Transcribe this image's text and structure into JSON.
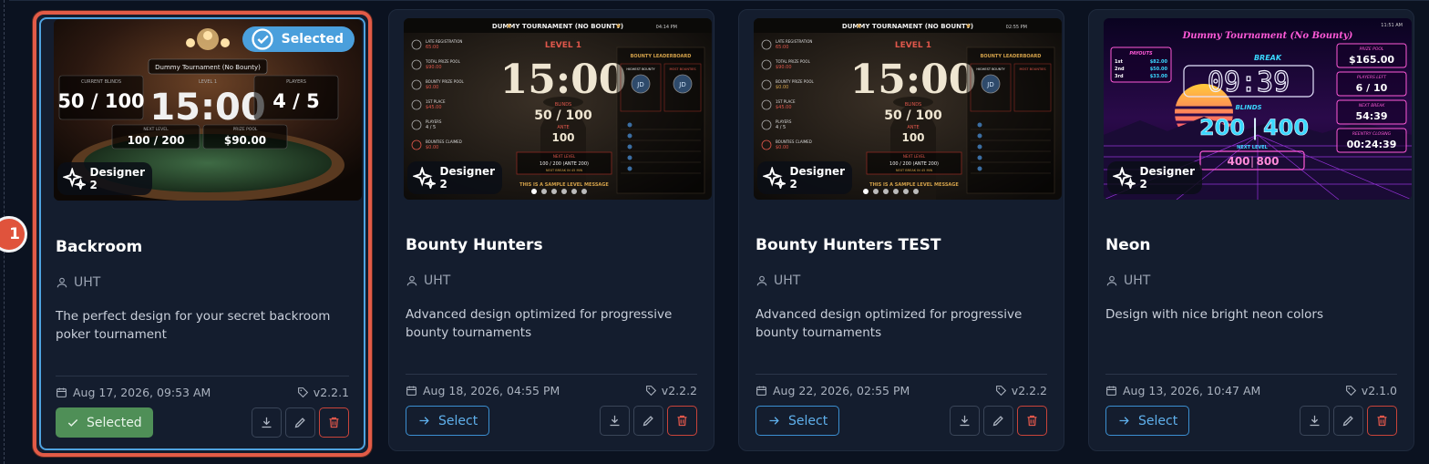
{
  "step_badge": "1",
  "cards": [
    {
      "title": "Backroom",
      "author": "UHT",
      "description": "The perfect design for your secret backroom poker tournament",
      "date": "Aug 17, 2026, 09:53 AM",
      "version": "v2.2.1",
      "designer": "Designer 2",
      "selected_chip": "Selected",
      "action_label": "Selected",
      "preview": {
        "header": "Dummy Tournament (No Bounty)",
        "blinds_label": "CURRENT BLINDS",
        "blinds": "50 / 100",
        "level_label": "LEVEL 1",
        "timer": "15:00",
        "players_label": "PLAYERS",
        "players": "4 / 5",
        "next_label": "NEXT LEVEL",
        "next_blinds": "100 / 200",
        "prize_label": "PRIZE POOL",
        "prize": "$90.00"
      }
    },
    {
      "title": "Bounty Hunters",
      "author": "UHT",
      "description": "Advanced design optimized for progressive bounty tournaments",
      "date": "Aug 18, 2026, 04:55 PM",
      "version": "v2.2.2",
      "designer": "Designer 2",
      "action_label": "Select",
      "preview": {
        "header": "DUMMY TOURNAMENT (NO BOUNTY)",
        "clock": "04:14 PM",
        "level": "LEVEL 1",
        "timer": "15:00",
        "blinds_label": "BLINDS",
        "blinds": "50 / 100",
        "ante_label": "ANTE",
        "ante": "100",
        "next_label": "NEXT LEVEL",
        "next_blinds": "100 / 200 (ANTE 200)",
        "next_break": "NEXT BREAK IN 45 MIN",
        "message": "THIS IS A SAMPLE LEVEL MESSAGE",
        "leaderboard": "BOUNTY LEADERBOARD",
        "highest_bounty": "HIGHEST BOUNTY",
        "most_bounties": "MOST BOUNTIES",
        "initials": "JD",
        "stats": [
          {
            "label": "LATE REGISTRATION",
            "value": "65:00"
          },
          {
            "label": "TOTAL PRIZE POOL",
            "value": "$90.00"
          },
          {
            "label": "BOUNTY PRIZE POOL",
            "value": "$0.00"
          },
          {
            "label": "1ST PLACE",
            "value": "$45.00"
          },
          {
            "label": "PLAYERS",
            "value": "4 / 5"
          },
          {
            "label": "BOUNTIES CLAIMED",
            "value": "$0.00"
          }
        ]
      }
    },
    {
      "title": "Bounty Hunters TEST",
      "author": "UHT",
      "description": "Advanced design optimized for progressive bounty tournaments",
      "date": "Aug 22, 2026, 02:55 PM",
      "version": "v2.2.2",
      "designer": "Designer 2",
      "action_label": "Select",
      "preview": {
        "header": "DUMMY TOURNAMENT (NO BOUNTY)",
        "clock": "02:55 PM",
        "level": "LEVEL 1",
        "timer": "15:00",
        "blinds_label": "BLINDS",
        "blinds": "50 / 100",
        "ante_label": "ANTE",
        "ante": "100",
        "next_label": "NEXT LEVEL",
        "next_blinds": "100 / 200 (ANTE 200)",
        "next_break": "NEXT BREAK IN 45 MIN",
        "message": "THIS IS A SAMPLE LEVEL MESSAGE",
        "leaderboard": "BOUNTY LEADERBOARD",
        "highest_bounty": "HIGHEST BOUNTY",
        "most_bounties": "MOST BOUNTIES",
        "initials": "JD",
        "stats": [
          {
            "label": "LATE REGISTRATION",
            "value": "65:00"
          },
          {
            "label": "TOTAL PRIZE POOL",
            "value": "$90.00"
          },
          {
            "label": "BOUNTY PRIZE POOL",
            "value": "$0.00"
          },
          {
            "label": "1ST PLACE",
            "value": "$45.00"
          },
          {
            "label": "PLAYERS",
            "value": "4 / 5"
          },
          {
            "label": "BOUNTIES CLAIMED",
            "value": "$0.00"
          }
        ]
      }
    },
    {
      "title": "Neon",
      "author": "UHT",
      "description": "Design with nice bright neon colors",
      "date": "Aug 13, 2026, 10:47 AM",
      "version": "v2.1.0",
      "designer": "Designer 2",
      "action_label": "Select",
      "preview": {
        "clock": "11:51 AM",
        "header": "Dummy Tournament (No Bounty)",
        "break_label": "BREAK",
        "timer": "09:39",
        "blinds_label": "BLINDS",
        "blinds_left": "200",
        "blinds_right": "400",
        "next_label": "NEXT LEVEL",
        "next_left": "400",
        "next_right": "800",
        "payouts_label": "PAYOUTS",
        "payouts": [
          {
            "place": "1st",
            "amount": "$82.00"
          },
          {
            "place": "2nd",
            "amount": "$50.00"
          },
          {
            "place": "3rd",
            "amount": "$33.00"
          }
        ],
        "prize_label": "PRIZE POOL",
        "prize": "$165.00",
        "players_label": "PLAYERS LEFT",
        "players": "6 / 10",
        "next_break_label": "NEXT BREAK",
        "next_break": "54:39",
        "reentry_label": "REENTRY CLOSING",
        "reentry": "00:24:39"
      }
    }
  ],
  "colors": {
    "accent": "#4a9fdc",
    "selected_green": "#4f8f57",
    "danger": "#e0574b",
    "highlight": "#e25b47"
  }
}
